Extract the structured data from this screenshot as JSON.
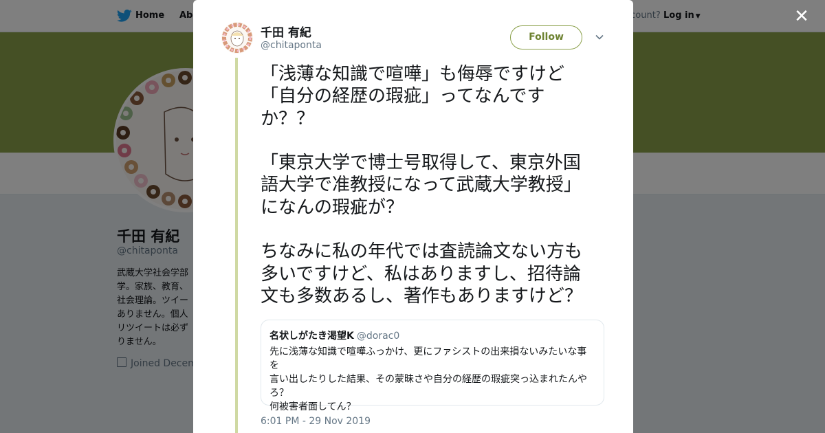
{
  "nav": {
    "home_label": "Home",
    "about_label": "Abo",
    "account_text": "ccount?",
    "login_label": "Log in"
  },
  "profile": {
    "name": "千田 有紀",
    "handle": "@chitaponta",
    "bio": "武蔵大学社会学部\n学。家族、教育、\n社会理論。ツイー\nありません。個人\nリツイートは必ず\nりません。",
    "joined": "Joined Decem",
    "banner_color": "#8aa04a"
  },
  "tweet": {
    "name": "千田 有紀",
    "handle": "@chitaponta",
    "follow_label": "Follow",
    "text": "「浅薄な知識で喧嘩」も侮辱ですけど\n「自分の経歴の瑕疵」ってなんです\nか？？\n\n「東京大学で博士号取得して、東京外国\n語大学で准教授になって武蔵大学教授」\nになんの瑕疵が？\n\nちなみに私の年代では査読論文ない方も\n多いですけど、私はありますし、招待論\n文も多数あるし、著作もありますけど？",
    "timestamp": "6:01 PM - 29 Nov 2019",
    "quote": {
      "name": "名状しがたき渇望K",
      "handle": "@dorac0",
      "text": "先に浅薄な知識で喧嘩ふっかけ、更にファシストの出来損ないみたいな事を\n言い出したりした結果、その蒙昧さや自分の経歴の瑕疵突っ込まれたんや\nろ？\n何被害者面してん？"
    }
  },
  "colors": {
    "accent": "#8aa04a",
    "link": "#1da1f2",
    "thread": "#cfd9a3"
  },
  "icons": {
    "twitter_bird": "twitter-bird-icon",
    "close": "close-icon",
    "chevron": "chevron-down-icon",
    "calendar": "calendar-icon"
  }
}
